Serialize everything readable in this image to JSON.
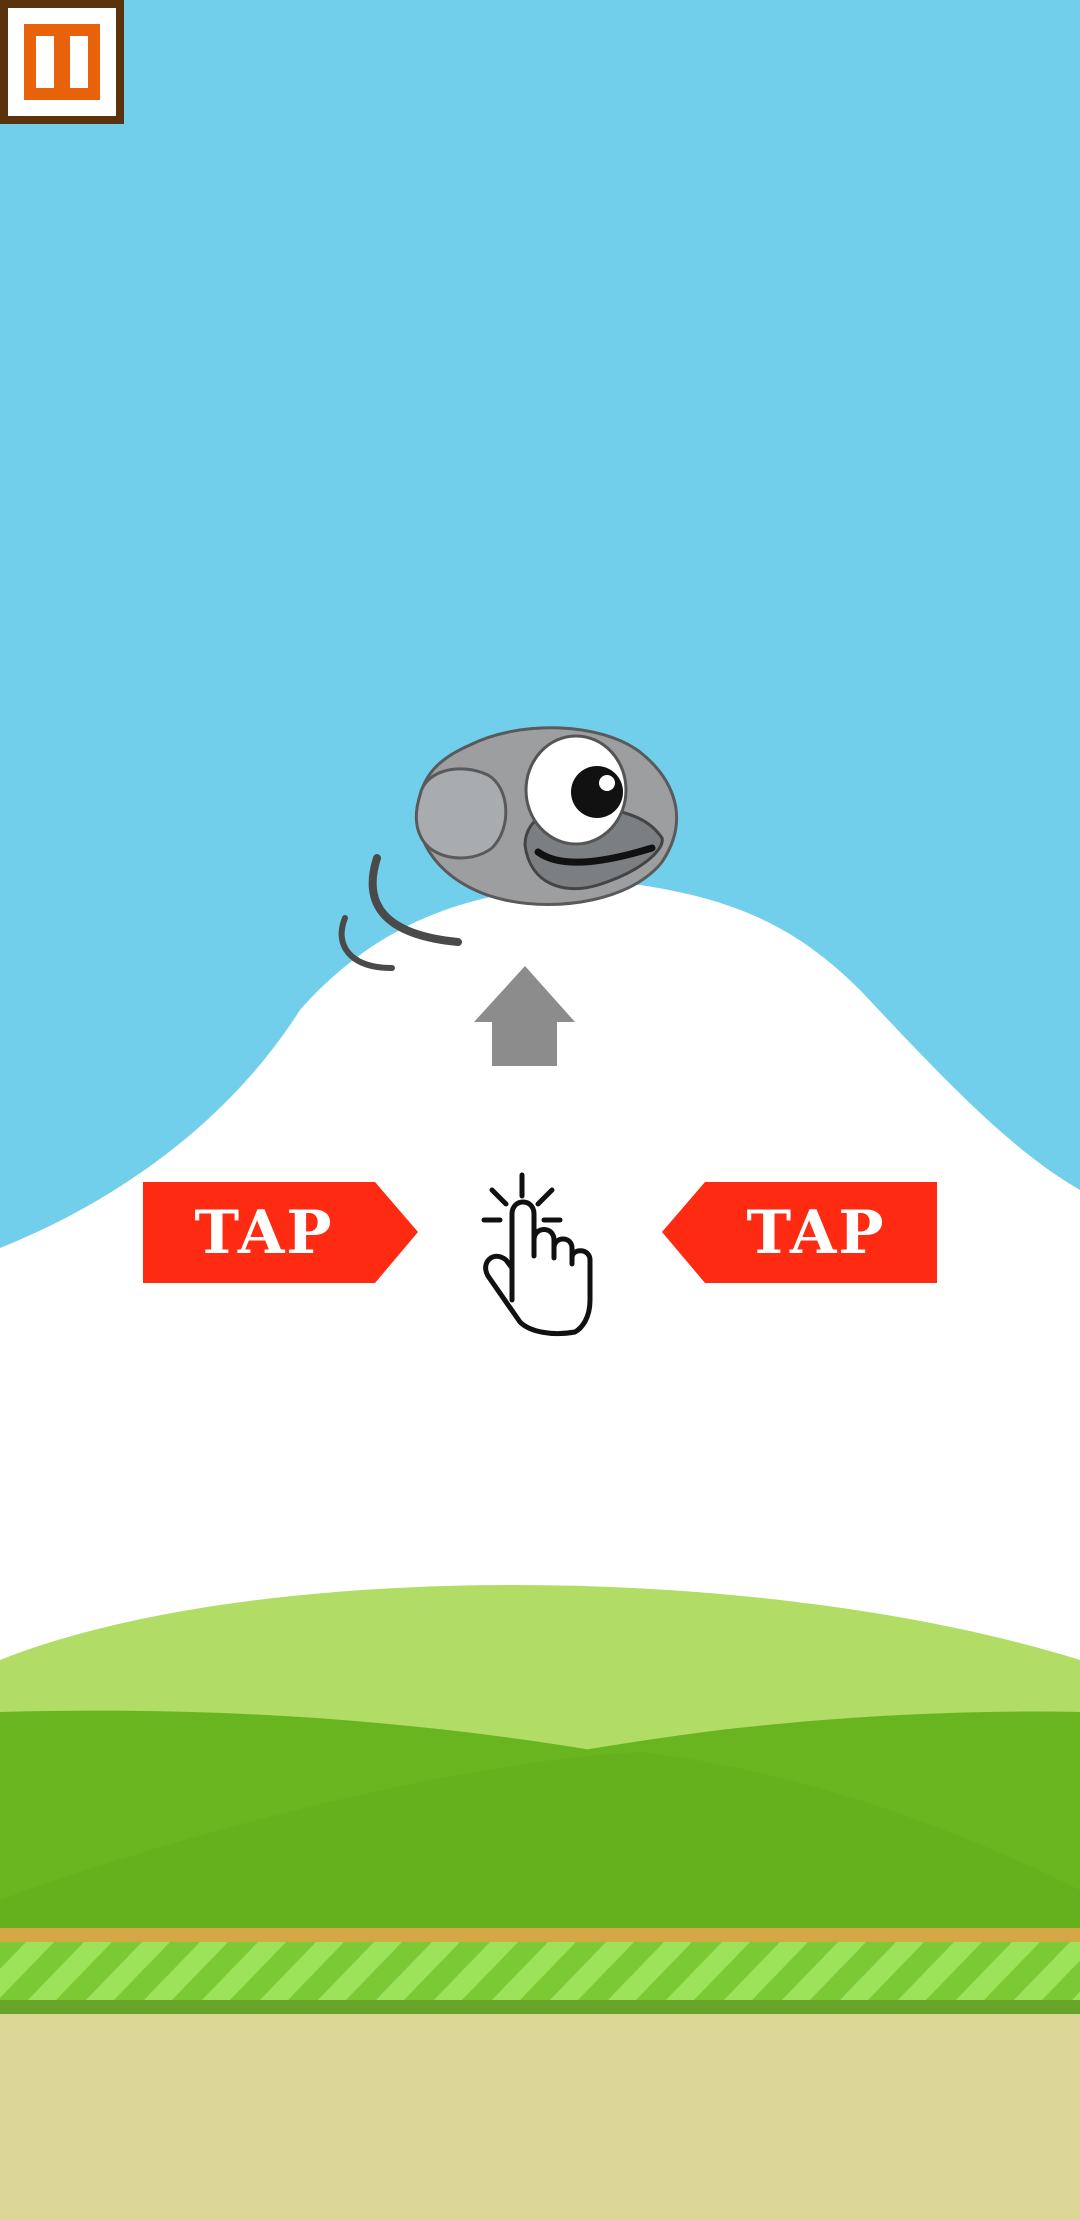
{
  "game": {
    "hint_left": "TAP",
    "hint_right": "TAP"
  },
  "controls": {
    "pause_icon": "pause-icon"
  },
  "colors": {
    "sky": "#72CFEC",
    "mountain": "#FFFFFF",
    "hill_light": "#B1DC66",
    "hill_dark": "#69B520",
    "stripe_light": "#9DE35A",
    "stripe_dark": "#7CC936",
    "ground": "#DDD797",
    "ground_edge": "#D5A745",
    "tap_banner": "#FF2A12",
    "pause_frame": "#5A330D",
    "pause_fill": "#E8620C",
    "bird_body": "#9C9EA0",
    "arrow": "#8C8C8C"
  }
}
